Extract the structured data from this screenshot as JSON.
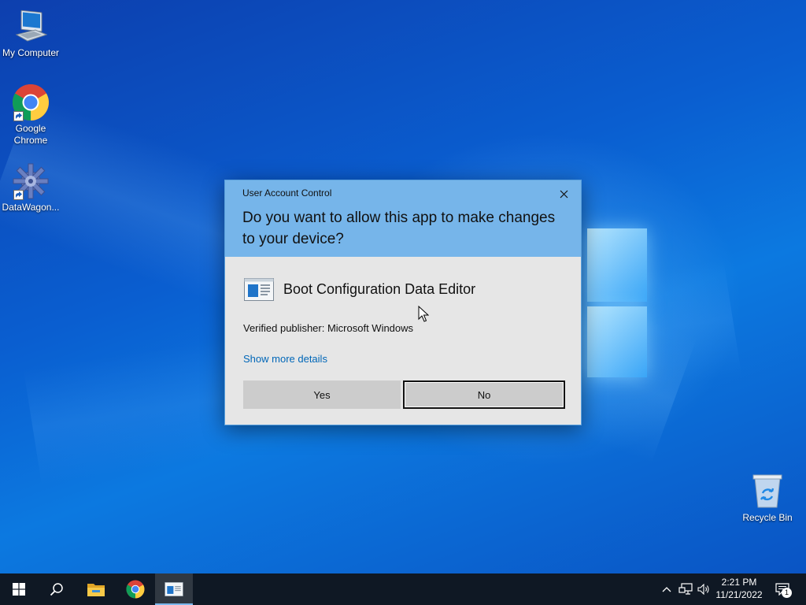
{
  "desktop": {
    "icons": [
      {
        "name": "my-computer",
        "label": "My Computer",
        "icon": "computer-icon"
      },
      {
        "name": "google-chrome",
        "label": "Google Chrome",
        "icon": "chrome-icon"
      },
      {
        "name": "datawagon",
        "label": "DataWagon...",
        "icon": "gear-icon"
      },
      {
        "name": "recycle-bin",
        "label": "Recycle Bin",
        "icon": "recycle-bin-icon"
      }
    ]
  },
  "uac": {
    "caption": "User Account Control",
    "question": "Do you want to allow this app to make changes to your device?",
    "app_name": "Boot Configuration Data Editor",
    "publisher": "Verified publisher: Microsoft Windows",
    "more_details": "Show more details",
    "yes_label": "Yes",
    "no_label": "No"
  },
  "taskbar": {
    "buttons": [
      "start-icon",
      "search-icon",
      "file-explorer-icon",
      "chrome-icon",
      "bcd-editor-icon"
    ],
    "active": "bcd-editor-icon",
    "tray": [
      "chevron-up-icon",
      "network-icon",
      "volume-icon"
    ],
    "time": "2:21 PM",
    "date": "11/21/2022",
    "notification_count": "1"
  },
  "colors": {
    "uac_header": "#76b5ea",
    "uac_body": "#e6e6e6",
    "link": "#0067b8",
    "taskbar": "#0f1824",
    "desktop": "#0a5ed0"
  }
}
